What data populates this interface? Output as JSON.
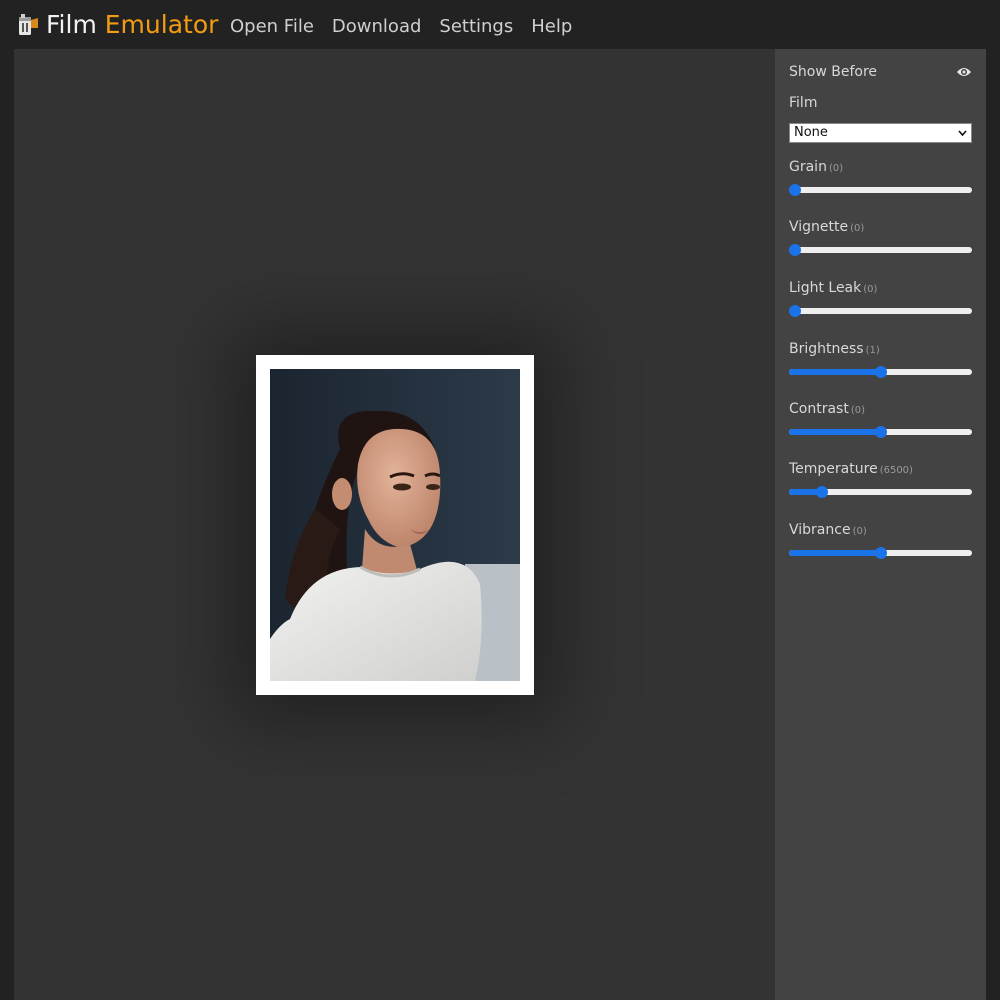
{
  "app": {
    "brand_part1": "Film",
    "brand_part2": "Emulator",
    "logo_icon": "film-canister-icon",
    "accent_color": "#f39c12"
  },
  "nav": {
    "items": [
      {
        "label": "Open File"
      },
      {
        "label": "Download"
      },
      {
        "label": "Settings"
      },
      {
        "label": "Help"
      }
    ]
  },
  "sidebar": {
    "show_before_label": "Show Before",
    "show_before_icon": "eye-icon",
    "film_label": "Film",
    "film_select_value": "None",
    "slider_color": "#1a73e8",
    "controls": [
      {
        "label": "Grain",
        "value": "(0)",
        "level": 0
      },
      {
        "label": "Vignette",
        "value": "(0)",
        "level": 0
      },
      {
        "label": "Light Leak",
        "value": "(0)",
        "level": 0
      },
      {
        "label": "Brightness",
        "value": "(1)",
        "level": 0.5
      },
      {
        "label": "Contrast",
        "value": "(0)",
        "level": 0.5
      },
      {
        "label": "Temperature",
        "value": "(6500)",
        "level": 0.18
      },
      {
        "label": "Vibrance",
        "value": "(0)",
        "level": 0.5
      }
    ]
  }
}
